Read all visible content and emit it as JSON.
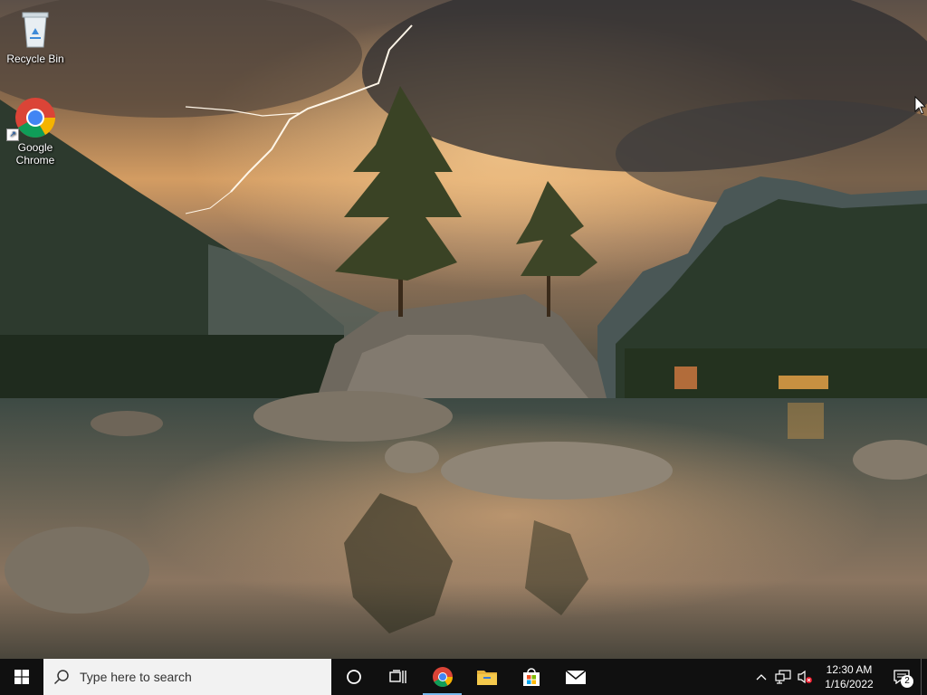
{
  "desktop": {
    "icons": [
      {
        "label": "Recycle Bin",
        "icon": "recycle-bin-icon"
      },
      {
        "label": "Google Chrome",
        "icon": "chrome-icon"
      }
    ]
  },
  "taskbar": {
    "start_icon": "windows-logo-icon",
    "search_placeholder": "Type here to search",
    "pinned": [
      {
        "name": "Cortana",
        "icon": "cortana-circle-icon"
      },
      {
        "name": "Task View",
        "icon": "task-view-icon"
      },
      {
        "name": "Google Chrome",
        "icon": "chrome-icon",
        "active": true
      },
      {
        "name": "File Explorer",
        "icon": "folder-icon"
      },
      {
        "name": "Microsoft Store",
        "icon": "store-bag-icon"
      },
      {
        "name": "Mail",
        "icon": "mail-icon"
      }
    ],
    "tray": {
      "icons": [
        "chevron-up-icon",
        "network-icon",
        "volume-muted-icon"
      ],
      "time": "12:30 AM",
      "date": "1/16/2022",
      "notification_count": "2"
    },
    "accent_color": "#76b9ed"
  }
}
